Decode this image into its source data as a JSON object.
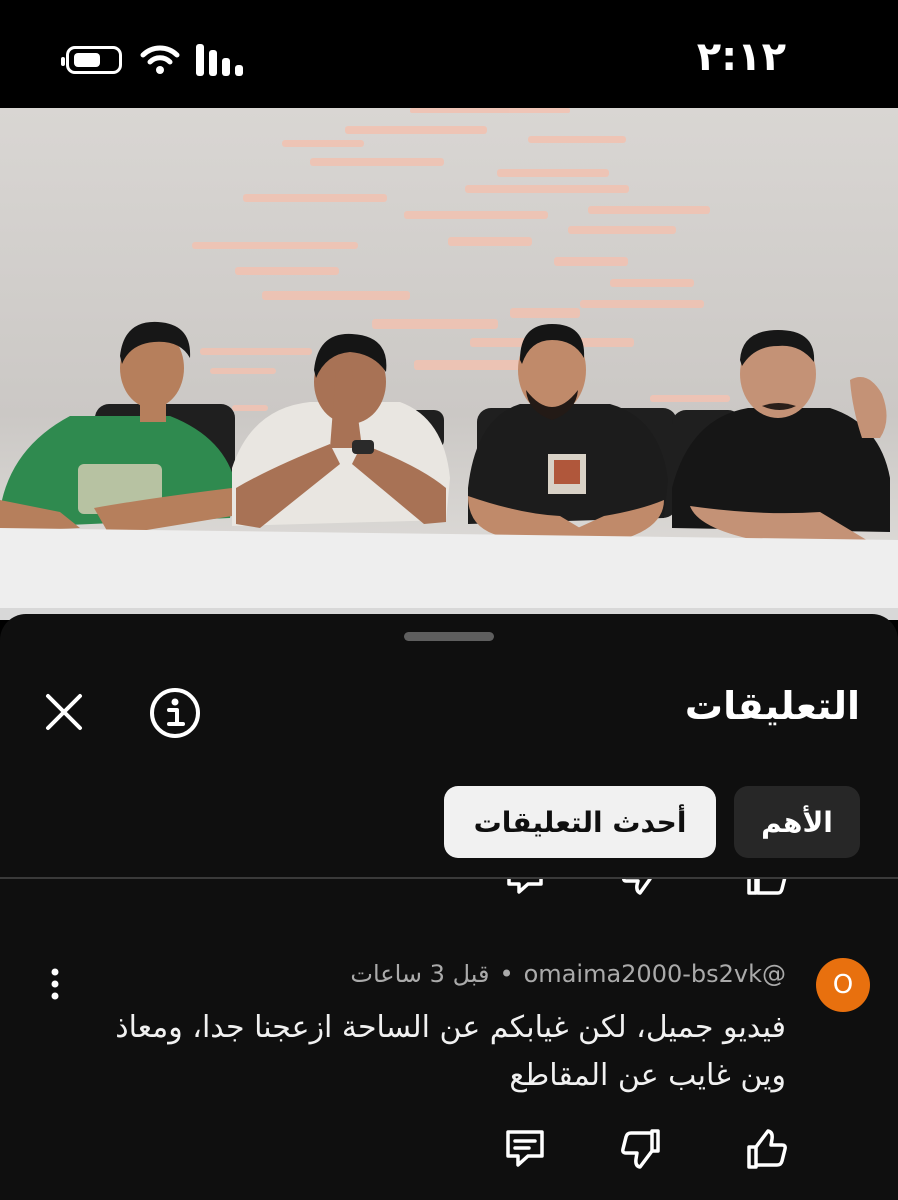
{
  "status_bar": {
    "time": "٢:١٢",
    "icons": [
      "battery-icon",
      "wifi-icon",
      "signal-icon"
    ]
  },
  "video": {
    "description_icon": "video-frame"
  },
  "comments_sheet": {
    "title": "التعليقات",
    "icons": [
      "close-icon",
      "info-icon"
    ],
    "sort_chips": [
      {
        "label": "الأهم",
        "selected": false
      },
      {
        "label": "أحدث التعليقات",
        "selected": true
      }
    ]
  },
  "comment": {
    "avatar_letter": "O",
    "avatar_color": "#e8700e",
    "author": "@omaima2000-bs2vk",
    "separator": "•",
    "time": "قبل 3 ساعات",
    "text": "فيديو جميل، لكن غيابكم عن الساحة ازعجنا جدا، ومعاذ وين غايب عن المقاطع",
    "actions": [
      "like-icon",
      "dislike-icon",
      "reply-icon",
      "more-icon"
    ]
  }
}
